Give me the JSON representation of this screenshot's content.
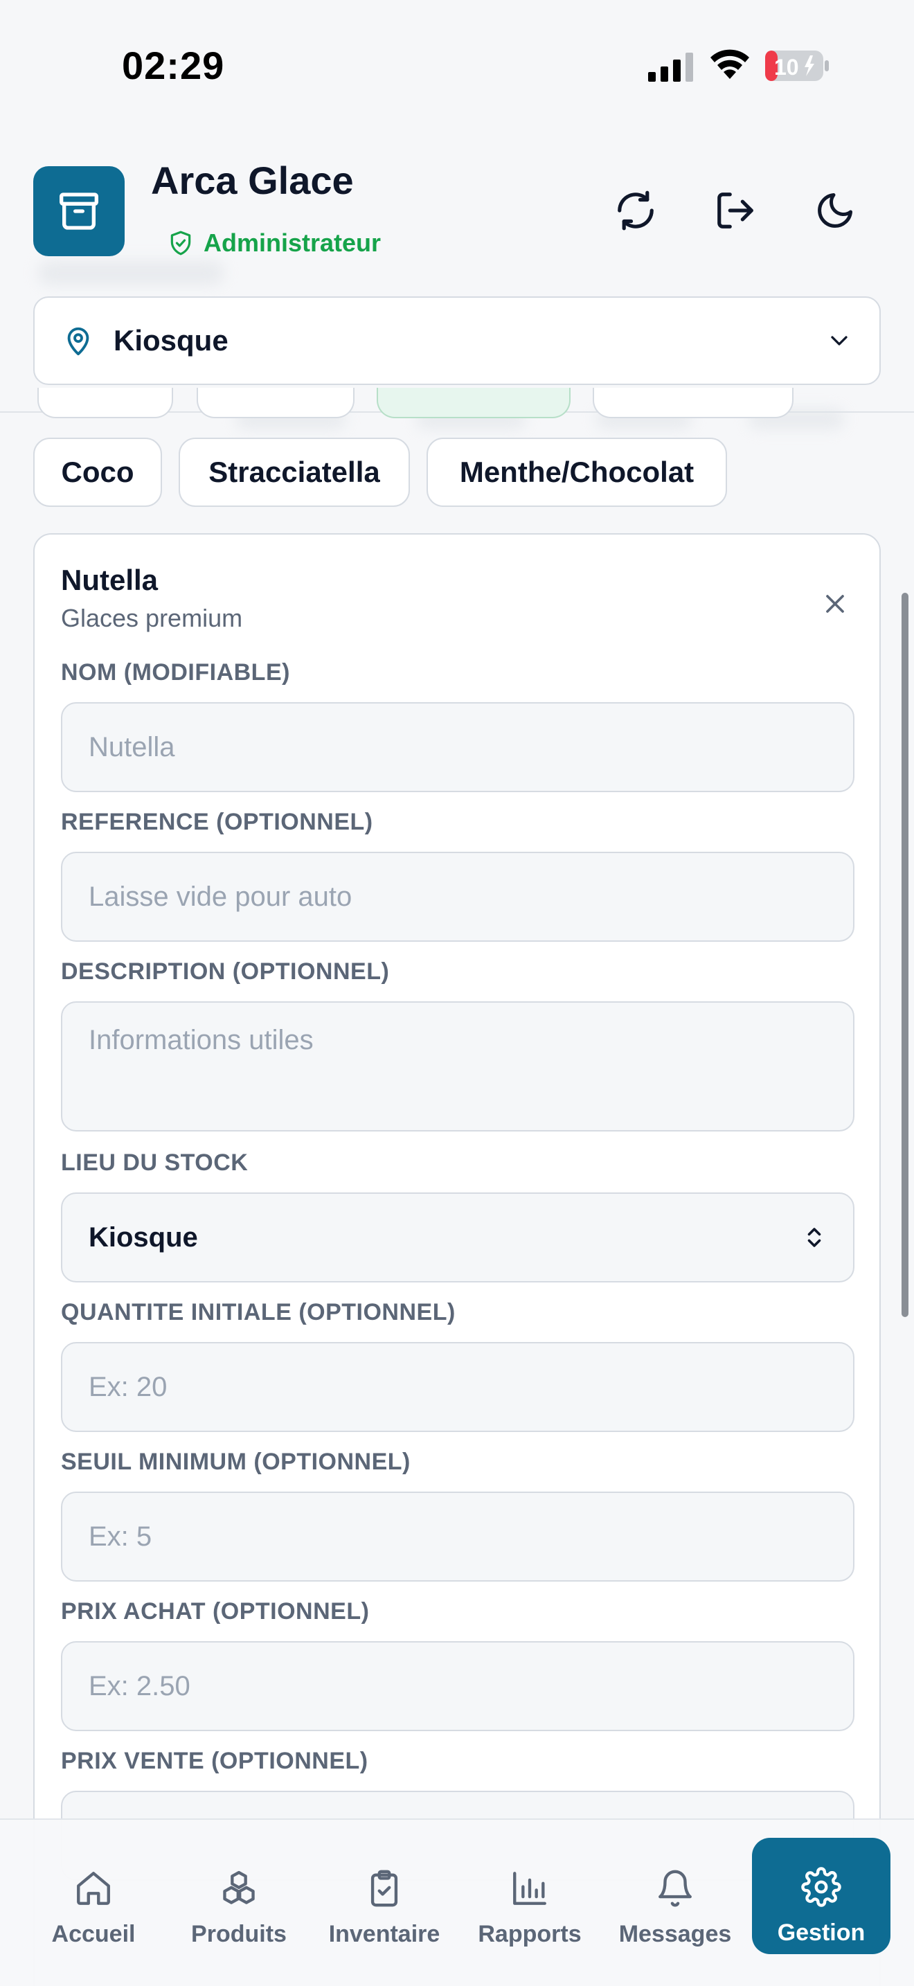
{
  "status_bar": {
    "time": "02:29",
    "battery": "10"
  },
  "header": {
    "app_title": "Arca Glace",
    "role": "Administrateur"
  },
  "location": {
    "value": "Kiosque"
  },
  "chips": [
    "Coco",
    "Stracciatella",
    "Menthe/Chocolat"
  ],
  "card": {
    "title": "Nutella",
    "subtitle": "Glaces premium",
    "fields": [
      {
        "label": "NOM (MODIFIABLE)",
        "placeholder": "Nutella"
      },
      {
        "label": "REFERENCE (OPTIONNEL)",
        "placeholder": "Laisse vide pour auto"
      },
      {
        "label": "DESCRIPTION (OPTIONNEL)",
        "placeholder": "Informations utiles"
      },
      {
        "label": "LIEU DU STOCK",
        "value": "Kiosque"
      },
      {
        "label": "QUANTITE INITIALE (OPTIONNEL)",
        "placeholder": "Ex: 20"
      },
      {
        "label": "SEUIL MINIMUM (OPTIONNEL)",
        "placeholder": "Ex: 5"
      },
      {
        "label": "PRIX ACHAT (OPTIONNEL)",
        "placeholder": "Ex: 2.50"
      },
      {
        "label": "PRIX VENTE (OPTIONNEL)",
        "placeholder": ""
      }
    ]
  },
  "nav": [
    {
      "label": "Accueil",
      "icon": "home-icon"
    },
    {
      "label": "Produits",
      "icon": "boxes-icon"
    },
    {
      "label": "Inventaire",
      "icon": "clipboard-check-icon"
    },
    {
      "label": "Rapports",
      "icon": "bar-chart-icon"
    },
    {
      "label": "Messages",
      "icon": "bell-icon"
    },
    {
      "label": "Gestion",
      "icon": "gear-icon",
      "active": true
    }
  ],
  "colors": {
    "brand": "#0e6c93",
    "success": "#16a34a",
    "muted": "#5b6677"
  }
}
